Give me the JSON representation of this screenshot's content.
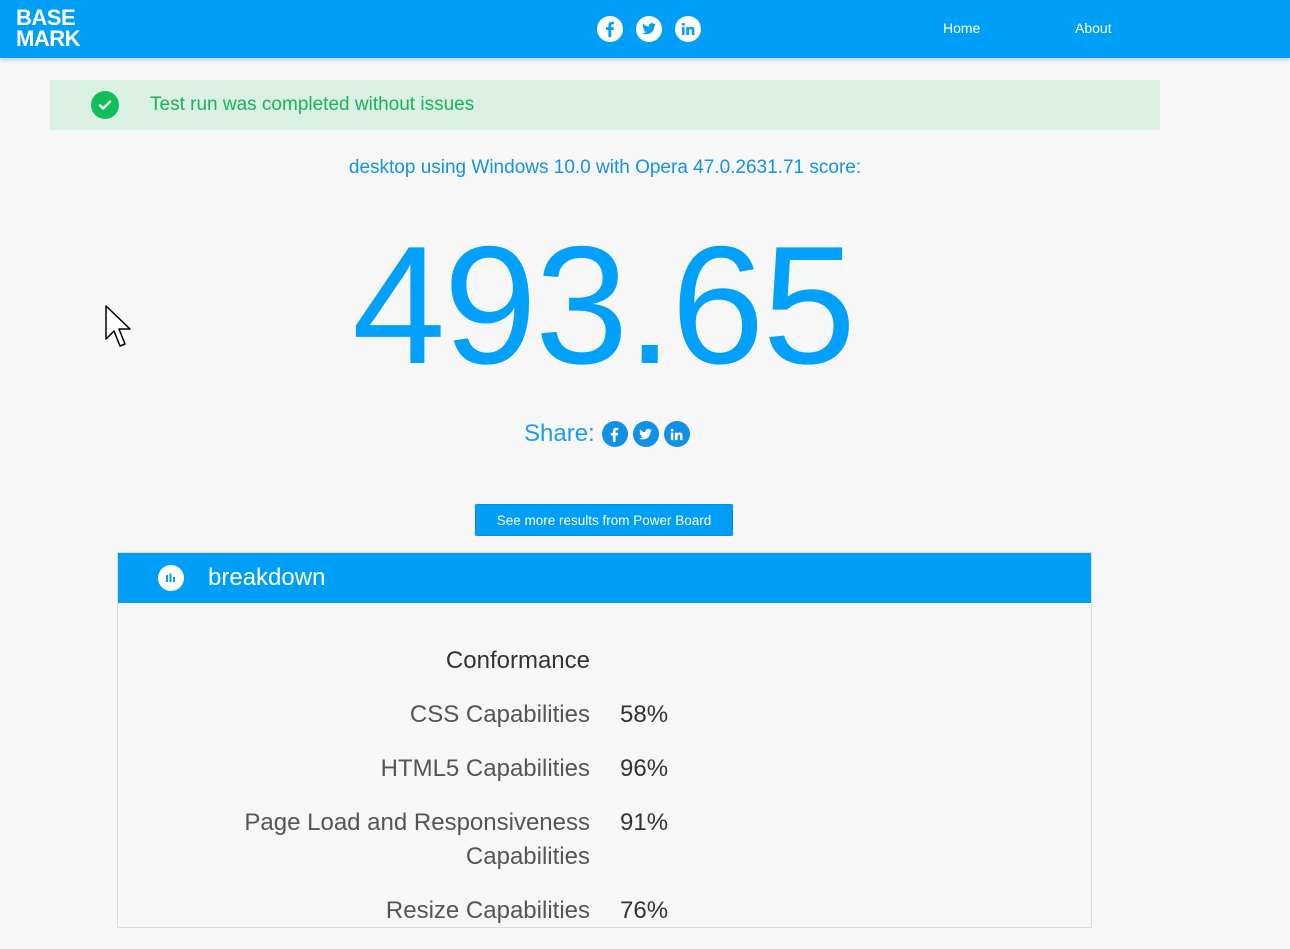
{
  "header": {
    "logo_line1": "BASE",
    "logo_line2": "MARK",
    "nav": [
      {
        "label": "Home"
      },
      {
        "label": "About"
      }
    ]
  },
  "alert": {
    "text": "Test run was completed without issues"
  },
  "result": {
    "device_line": "desktop using Windows 10.0 with Opera 47.0.2631.71 score:",
    "score": "493.65",
    "share_label": "Share:"
  },
  "more_button": "See more results from Power Board",
  "breakdown": {
    "title": "breakdown",
    "section_title": "Conformance",
    "rows": [
      {
        "label": "CSS Capabilities",
        "value": "58%"
      },
      {
        "label": "HTML5 Capabilities",
        "value": "96%"
      },
      {
        "label": "Page Load and Responsiveness Capabilities",
        "value": "91%"
      },
      {
        "label": "Resize Capabilities",
        "value": "76%"
      }
    ]
  },
  "colors": {
    "brand": "#009ff7",
    "success": "#0fbf5a",
    "alert_bg": "#d9f0e3"
  }
}
